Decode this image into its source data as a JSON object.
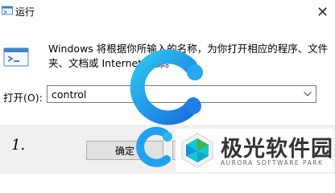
{
  "window": {
    "title": "运行",
    "close_glyph": "✕"
  },
  "dialog": {
    "description": "Windows 将根据你所输入的名称，为你打开相应的程序、文件\n夹、文档或 Internet 资源。",
    "open_label": "打开(O):",
    "open_value": "control"
  },
  "footer": {
    "step_number": "1.",
    "ok_label": "确定"
  },
  "icons": [
    "run-app-icon",
    "close-icon",
    "run-dialog-icon",
    "chevron-down-icon",
    "c-logo-icon",
    "aurora-logo-icon"
  ],
  "watermark": {
    "name": "极光软件园",
    "subtitle": "AURORA SOFTWARE PARK"
  },
  "colors": {
    "accent_blue": "#2aa0f0",
    "logo_cyan": "#14c6d6",
    "logo_green": "#3fb44a",
    "footer_bg": "#f0f0f0",
    "button_bg": "#e1e1e1"
  }
}
